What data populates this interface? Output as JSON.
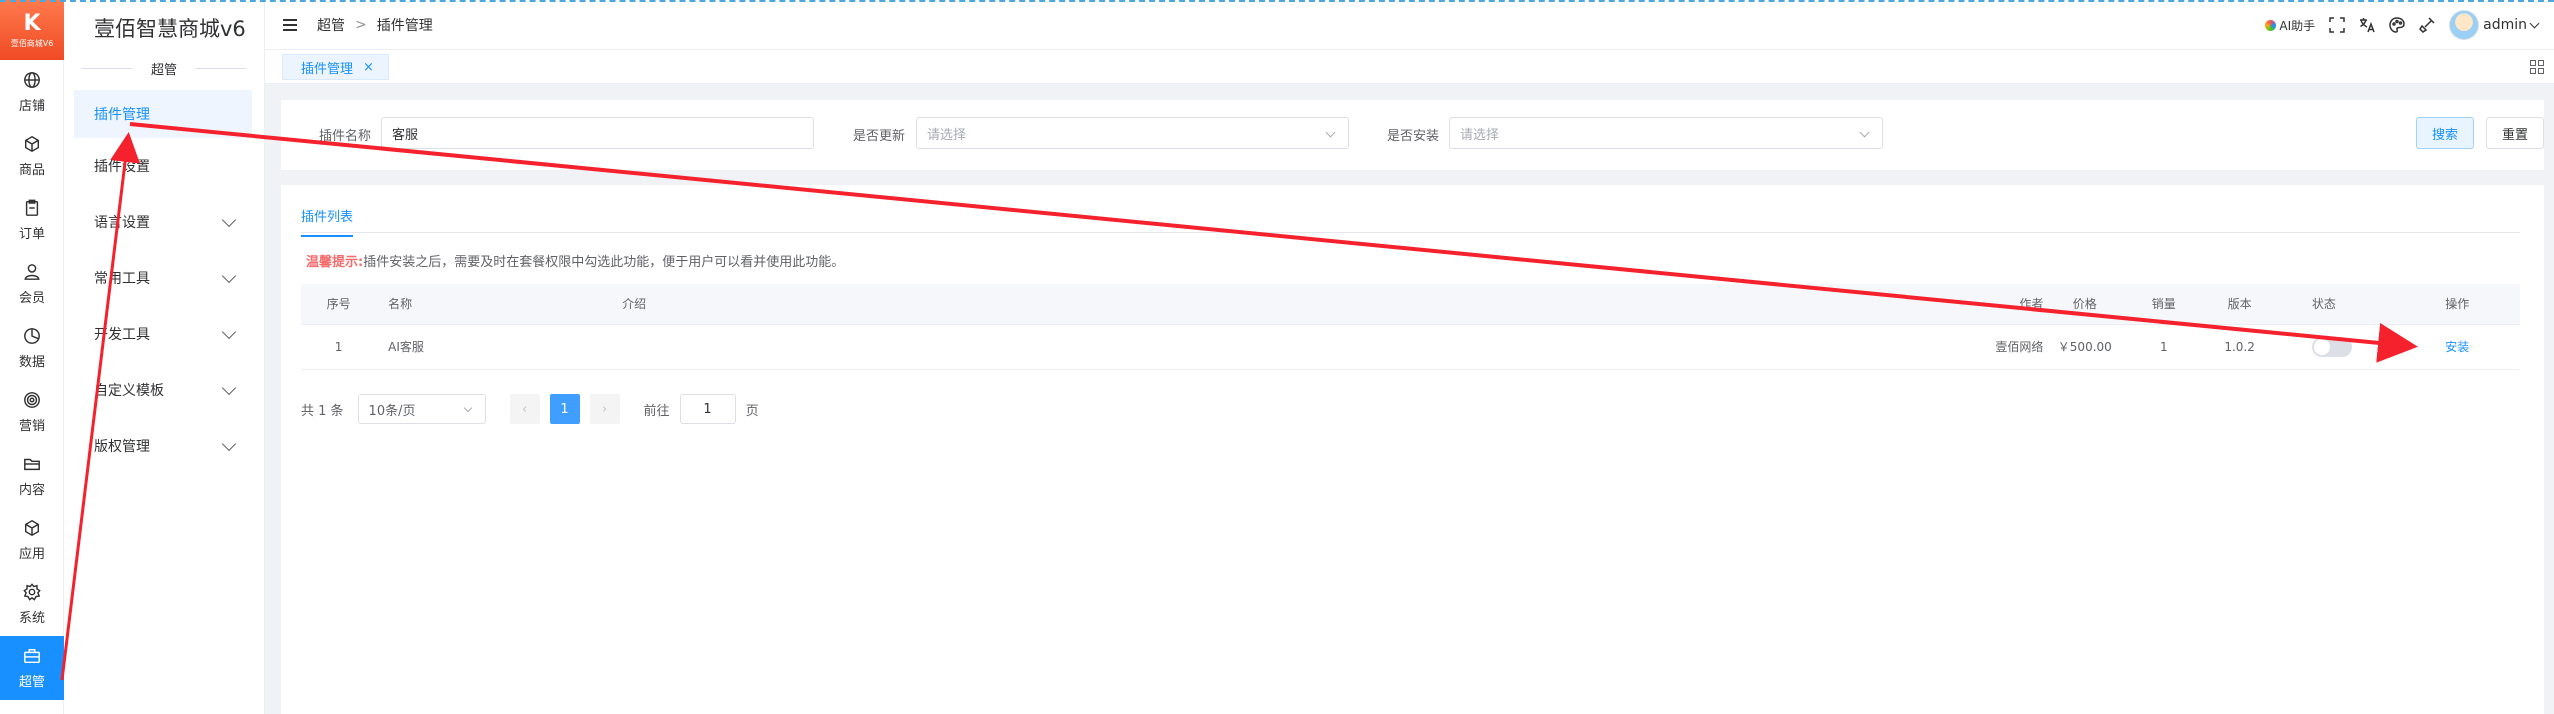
{
  "app": {
    "logo_text": "K",
    "logo_sub": "壹佰商城V6",
    "name": "壹佰智慧商城v6"
  },
  "rail": [
    {
      "label": "店铺",
      "icon": "globe-icon"
    },
    {
      "label": "商品",
      "icon": "box-icon"
    },
    {
      "label": "订单",
      "icon": "clipboard-icon"
    },
    {
      "label": "会员",
      "icon": "user-icon"
    },
    {
      "label": "数据",
      "icon": "pie-chart-icon"
    },
    {
      "label": "营销",
      "icon": "target-icon"
    },
    {
      "label": "内容",
      "icon": "folder-icon"
    },
    {
      "label": "应用",
      "icon": "cube-icon"
    },
    {
      "label": "系统",
      "icon": "gear-icon"
    },
    {
      "label": "超管",
      "icon": "briefcase-icon",
      "active": true
    }
  ],
  "sidebar": {
    "section": "超管",
    "items": [
      {
        "label": "插件管理",
        "active": true,
        "expandable": false
      },
      {
        "label": "插件设置",
        "expandable": false
      },
      {
        "label": "语言设置",
        "expandable": true
      },
      {
        "label": "常用工具",
        "expandable": true
      },
      {
        "label": "开发工具",
        "expandable": true
      },
      {
        "label": "自定义模板",
        "expandable": true
      },
      {
        "label": "版权管理",
        "expandable": true
      }
    ]
  },
  "header": {
    "breadcrumb": [
      "超管",
      "插件管理"
    ],
    "breadcrumb_sep": ">",
    "ai_label": "AI助手",
    "username": "admin"
  },
  "tabs": [
    {
      "label": "插件管理",
      "close": "×"
    }
  ],
  "filters": {
    "name_label": "插件名称",
    "name_value": "客服",
    "update_label": "是否更新",
    "update_placeholder": "请选择",
    "install_label": "是否安装",
    "install_placeholder": "请选择",
    "search_button": "搜索",
    "reset_button": "重置"
  },
  "list": {
    "tab": "插件列表",
    "tip_label": "温馨提示:",
    "tip_text": "插件安装之后，需要及时在套餐权限中勾选此功能，便于用户可以看并使用此功能。",
    "columns": [
      "序号",
      "名称",
      "介绍",
      "作者",
      "价格",
      "销量",
      "版本",
      "状态",
      "操作"
    ],
    "rows": [
      {
        "index": "1",
        "name": "AI客服",
        "intro": "",
        "author": "壹佰网络",
        "price": "￥500.00",
        "sales": "1",
        "version": "1.0.2",
        "enabled": false,
        "action": "安装"
      }
    ]
  },
  "pagination": {
    "total": "共 1 条",
    "page_size": "10条/页",
    "prev": "‹",
    "current": "1",
    "next": "›",
    "goto_label": "前往",
    "goto_value": "1",
    "goto_unit": "页"
  },
  "colors": {
    "accent": "#1890ff",
    "annotation": "#f5222d",
    "warning": "#f56c6c"
  }
}
